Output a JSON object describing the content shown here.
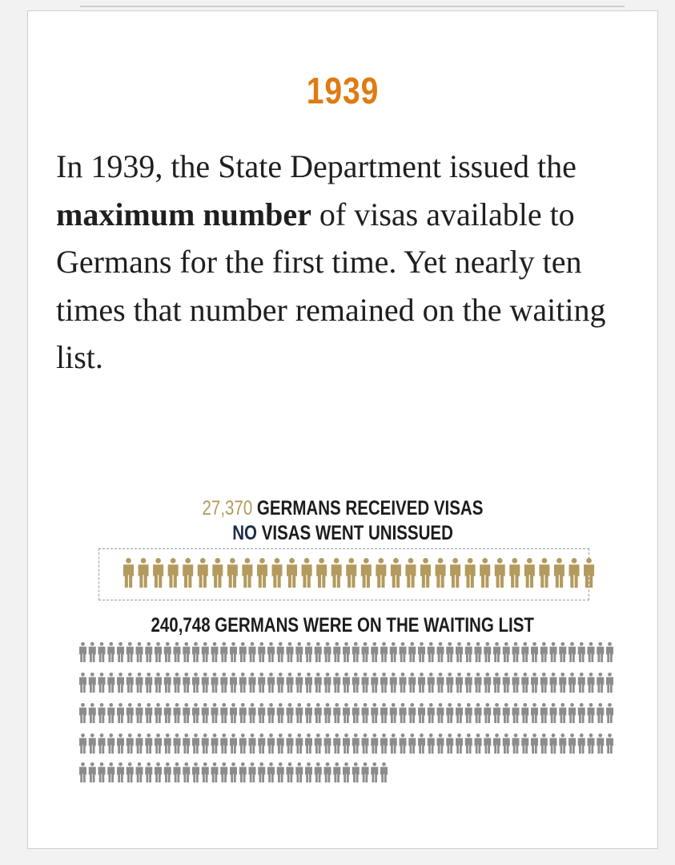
{
  "year": "1939",
  "paragraph": {
    "before": "In 1939, the State Department issued the ",
    "bold": "maximum number",
    "after": " of visas available to Germans for the first time. Yet nearly ten times that number remained on the waiting list."
  },
  "visas_line": {
    "number": "27,370",
    "text": " GERMANS RECEIVED VISAS"
  },
  "unissued_line": {
    "number": "NO",
    "text": " VISAS WENT UNISSUED"
  },
  "waiting_line": {
    "text": "240,748 GERMANS WERE ON THE WAITING LIST"
  },
  "colors": {
    "accent": "#e07b12",
    "visa_icon": "#b39a5d",
    "waiting_icon": "#8c8c8c",
    "navy": "#1d2c4a"
  },
  "icon": "person-icon",
  "chart_data": {
    "type": "pictogram",
    "series": [
      {
        "name": "GERMANS RECEIVED VISAS",
        "value": 27370,
        "icons": 30
      },
      {
        "name": "VISAS WENT UNISSUED",
        "value": 0,
        "icons": 0
      },
      {
        "name": "GERMANS WERE ON THE WAITING LIST",
        "value": 240748,
        "icons": 263
      }
    ],
    "icon_rows": [
      32,
      57,
      57,
      57,
      57,
      33
    ]
  }
}
